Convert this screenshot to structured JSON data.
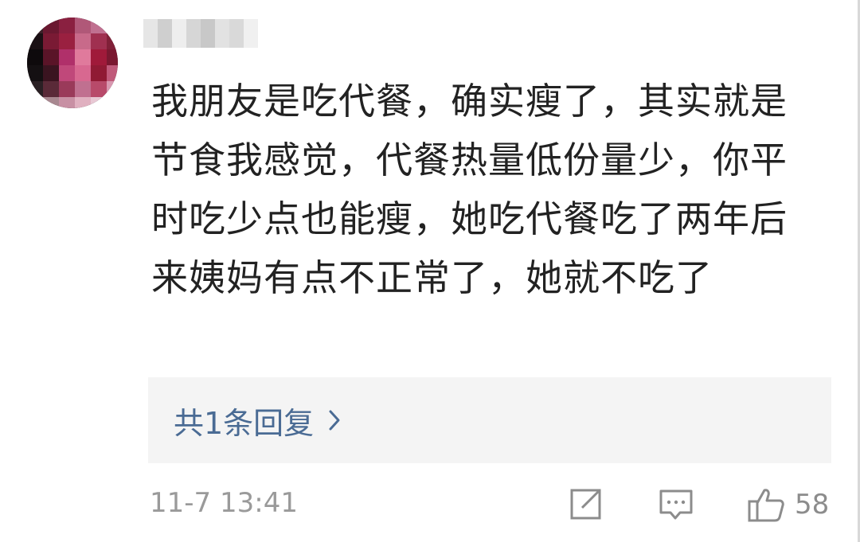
{
  "comment": {
    "text": "我朋友是吃代餐，确实瘦了，其实就是节食我感觉，代餐热量低份量少，你平时吃少点也能瘦，她吃代餐吃了两年后来姨妈有点不正常了，她就不吃了",
    "timestamp": "11-7 13:41",
    "replies_label": "共1条回复",
    "like_count": "58"
  },
  "icons": {
    "avatar": "avatar-blurred",
    "username": "username-blurred",
    "replies_chevron": "chevron-right-icon",
    "share": "share-icon",
    "reply": "comment-icon",
    "like": "thumbs-up-icon"
  },
  "colors": {
    "text": "#222222",
    "link": "#4a6b94",
    "muted": "#9a9a9a",
    "panel": "#f4f4f4"
  }
}
